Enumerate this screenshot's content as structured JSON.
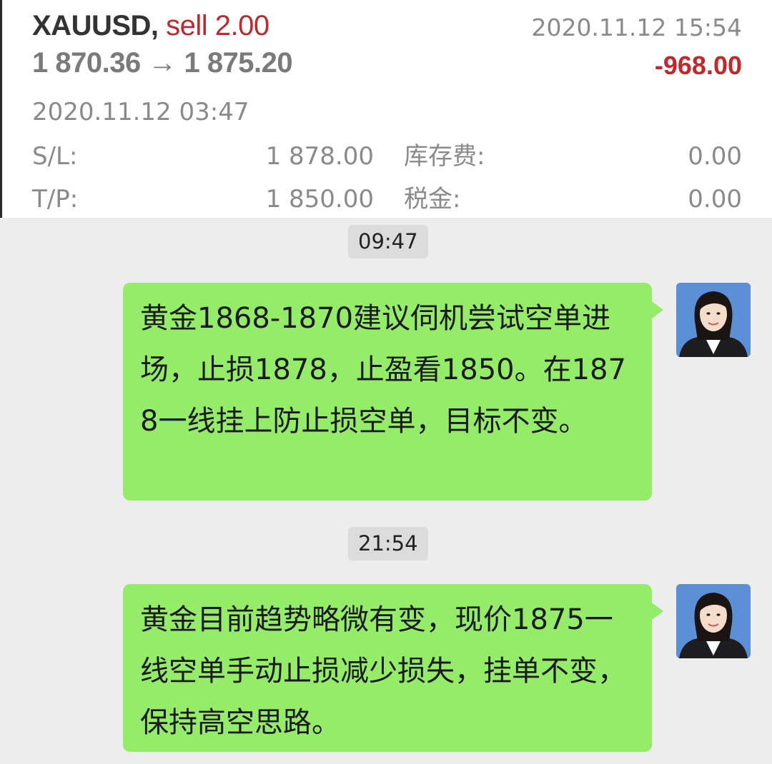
{
  "trade": {
    "symbol": "XAUUSD,",
    "side": "sell 2.00",
    "open_price": "1 870.36",
    "arrow": "→",
    "current_price": "1 875.20",
    "close_time": "2020.11.12 15:54",
    "profit": "-968.00",
    "open_time": "2020.11.12 03:47",
    "sl_label": "S/L:",
    "sl_value": "1 878.00",
    "tp_label": "T/P:",
    "tp_value": "1 850.00",
    "swap_label": "库存费:",
    "swap_value": "0.00",
    "tax_label": "税金:",
    "tax_value": "0.00"
  },
  "chat": {
    "messages": [
      {
        "time": "09:47",
        "text": "黄金1868-1870建议伺机尝试空单进场，止损1878，止盈看1850。在1878一线挂上防止损空单，目标不变。"
      },
      {
        "time": "21:54",
        "text": "黄金目前趋势略微有变，现价1875一线空单手动止损减少损失，挂单不变，保持高空思路。"
      }
    ]
  },
  "colors": {
    "bubble": "#95ec69",
    "loss": "#c0282b",
    "chat_bg": "#ededed",
    "avatar_bg": "#5b8fd6"
  },
  "icons": {
    "avatar": "user-avatar-photo"
  }
}
